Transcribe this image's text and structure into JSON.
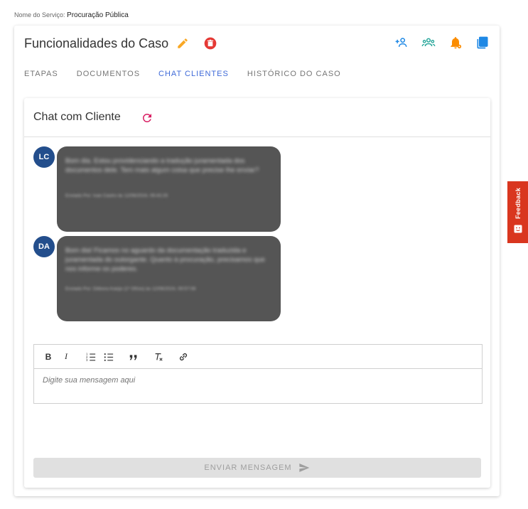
{
  "service": {
    "label": "Nome do Serviço:",
    "value": "Procuração Pública"
  },
  "case": {
    "title": "Funcionalidades do Caso"
  },
  "tabs": [
    {
      "label": "ETAPAS",
      "active": false
    },
    {
      "label": "DOCUMENTOS",
      "active": false
    },
    {
      "label": "CHAT CLIENTES",
      "active": true
    },
    {
      "label": "HISTÓRICO DO CASO",
      "active": false
    }
  ],
  "chat": {
    "title": "Chat com Cliente",
    "messages": [
      {
        "avatar": "LC",
        "text": "Bom dia. Estou providenciando a tradução juramentada dos documentos dele. Tem mais algum coisa que precise lhe enviar?",
        "meta": "Enviado Por: Ivan Castro às 12/06/2024, 09:43:25"
      },
      {
        "avatar": "DA",
        "text": "Bom dia! Ficamos no aguardo da documentação traduzida e juramentada do outorgante. Quanto à procuração, precisamos que nos informe os poderes.",
        "meta": "Enviado Por: Débora Araújo (1º Ofício) às 12/06/2024, 09:57:08"
      }
    ],
    "editor_placeholder": "Digite sua mensagem aqui",
    "send_label": "ENVIAR MENSAGEM"
  },
  "feedback": {
    "label": "Feedback"
  },
  "colors": {
    "accent": "#3f6ad8",
    "pencil": "#f9a825",
    "delete": "#e53935",
    "add_user": "#1e88e5",
    "group": "#26a69a",
    "bell": "#fb8c00",
    "copy": "#1e88e5",
    "bubble": "#555555",
    "avatar": "#234e8c",
    "feedback": "#d9361f"
  }
}
